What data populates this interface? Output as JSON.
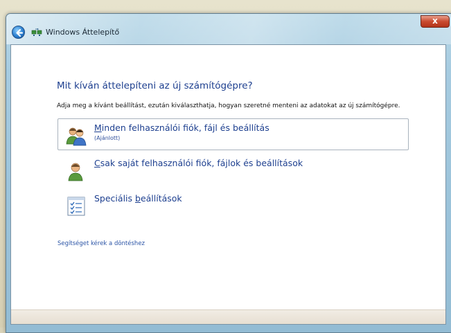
{
  "window": {
    "title": "Windows Áttelepítő",
    "close_label": "x"
  },
  "page": {
    "heading": "Mit kíván áttelepíteni az új számítógépre?",
    "instruction": "Adja meg a kívánt beállítást, ezután kiválaszthatja, hogyan szeretné menteni az adatokat az új számítógépre."
  },
  "options": [
    {
      "accel": "M",
      "rest": "inden felhasználói fiók, fájl és beállítás",
      "subtitle": "(Ajánlott)",
      "icon": "users-group-icon",
      "selected": true
    },
    {
      "accel": "C",
      "rest": "sak saját felhasználói fiók, fájlok és beállítások",
      "subtitle": "",
      "icon": "single-user-icon",
      "selected": false
    },
    {
      "prefix": "Speciális ",
      "accel": "b",
      "rest": "eállítások",
      "subtitle": "",
      "icon": "checklist-icon",
      "selected": false
    }
  ],
  "help": {
    "link": "Segítséget kérek a döntéshez"
  }
}
